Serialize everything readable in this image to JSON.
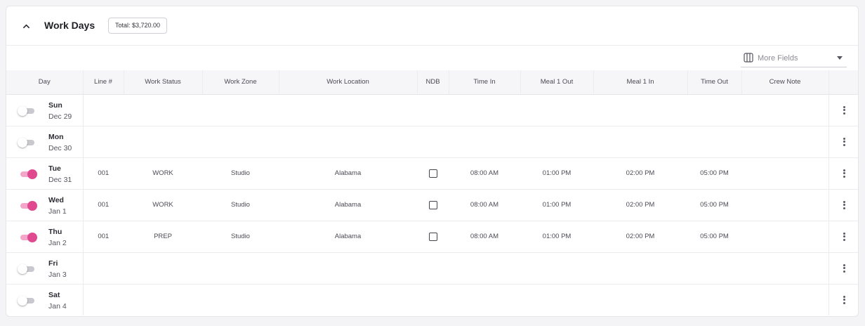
{
  "section": {
    "title": "Work Days",
    "total_badge": "Total: $3,720.00",
    "more_fields": {
      "label": "More Fields",
      "icon": "columns-icon"
    }
  },
  "colors": {
    "toggle_on": "#e0498f",
    "toggle_off": "#c8c8ce"
  },
  "table": {
    "headers": [
      "Day",
      "Line #",
      "Work Status",
      "Work Zone",
      "Work Location",
      "NDB",
      "Time In",
      "Meal 1 Out",
      "Meal 1 In",
      "Time Out",
      "Crew Note"
    ],
    "rows": [
      {
        "enabled": false,
        "day": "Sun",
        "date": "Dec 29",
        "line": "",
        "status": "",
        "zone": "",
        "location": "",
        "ndb": false,
        "time_in": "",
        "meal1_out": "",
        "meal1_in": "",
        "time_out": "",
        "crew_note": ""
      },
      {
        "enabled": false,
        "day": "Mon",
        "date": "Dec 30",
        "line": "",
        "status": "",
        "zone": "",
        "location": "",
        "ndb": false,
        "time_in": "",
        "meal1_out": "",
        "meal1_in": "",
        "time_out": "",
        "crew_note": ""
      },
      {
        "enabled": true,
        "day": "Tue",
        "date": "Dec 31",
        "line": "001",
        "status": "WORK",
        "zone": "Studio",
        "location": "Alabama",
        "ndb": false,
        "time_in": "08:00 AM",
        "meal1_out": "01:00 PM",
        "meal1_in": "02:00 PM",
        "time_out": "05:00 PM",
        "crew_note": ""
      },
      {
        "enabled": true,
        "day": "Wed",
        "date": "Jan 1",
        "line": "001",
        "status": "WORK",
        "zone": "Studio",
        "location": "Alabama",
        "ndb": false,
        "time_in": "08:00 AM",
        "meal1_out": "01:00 PM",
        "meal1_in": "02:00 PM",
        "time_out": "05:00 PM",
        "crew_note": ""
      },
      {
        "enabled": true,
        "day": "Thu",
        "date": "Jan 2",
        "line": "001",
        "status": "PREP",
        "zone": "Studio",
        "location": "Alabama",
        "ndb": false,
        "time_in": "08:00 AM",
        "meal1_out": "01:00 PM",
        "meal1_in": "02:00 PM",
        "time_out": "05:00 PM",
        "crew_note": ""
      },
      {
        "enabled": false,
        "day": "Fri",
        "date": "Jan 3",
        "line": "",
        "status": "",
        "zone": "",
        "location": "",
        "ndb": false,
        "time_in": "",
        "meal1_out": "",
        "meal1_in": "",
        "time_out": "",
        "crew_note": ""
      },
      {
        "enabled": false,
        "day": "Sat",
        "date": "Jan 4",
        "line": "",
        "status": "",
        "zone": "",
        "location": "",
        "ndb": false,
        "time_in": "",
        "meal1_out": "",
        "meal1_in": "",
        "time_out": "",
        "crew_note": ""
      }
    ]
  }
}
